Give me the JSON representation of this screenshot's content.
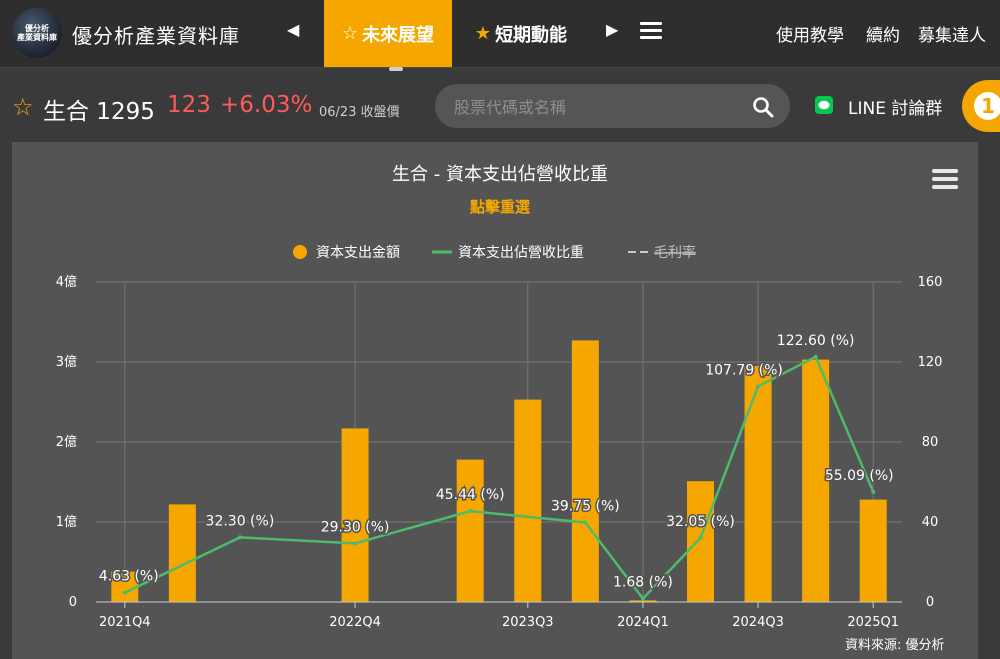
{
  "nav": {
    "logo_line1": "優分析",
    "logo_line2": "產業資料庫",
    "site_title": "優分析產業資料庫",
    "tabs": [
      {
        "label": "未來展望",
        "active": true
      },
      {
        "label": "短期動能",
        "active": false
      }
    ],
    "right_links": [
      "使用教學",
      "續約",
      "募集達人"
    ]
  },
  "stock": {
    "name_code": "生合 1295",
    "price": "123",
    "change": "+6.03%",
    "date_note": "06/23 收盤價"
  },
  "search": {
    "placeholder": "股票代碼或名稱"
  },
  "line_group": "LINE 討論群",
  "badge_number": "1",
  "colors": {
    "accent": "#f5a700",
    "up": "#ff5a5a",
    "line": "#4cbb6c"
  },
  "chart_data": {
    "type": "bar+line",
    "title": "生合 - 資本支出佔營收比重",
    "subtitle": "點擊重選",
    "legend": [
      {
        "name": "資本支出金額",
        "marker": "circle",
        "color": "#f5a700"
      },
      {
        "name": "資本支出佔營收比重",
        "marker": "line",
        "color": "#4cbb6c"
      },
      {
        "name": "毛利率",
        "marker": "dash",
        "color": "#cccccc",
        "disabled": true
      }
    ],
    "categories": [
      "2021Q4",
      "2022Q1",
      "2022Q2",
      "2022Q3",
      "2022Q4",
      "2023Q1",
      "2023Q2",
      "2023Q3",
      "2023Q4",
      "2024Q1",
      "2024Q2",
      "2024Q3",
      "2024Q4",
      "2025Q1"
    ],
    "x_tick_labels": {
      "0": "2021Q4",
      "4": "2022Q4",
      "7": "2023Q3",
      "9": "2024Q1",
      "11": "2024Q3",
      "13": "2025Q1"
    },
    "series": [
      {
        "name": "資本支出金額",
        "axis": "left",
        "unit": "億",
        "values": [
          0.38,
          1.22,
          null,
          null,
          2.17,
          null,
          1.78,
          2.53,
          3.27,
          0.02,
          1.51,
          2.95,
          3.03,
          1.28
        ]
      },
      {
        "name": "資本支出佔營收比重",
        "axis": "right",
        "values": [
          4.63,
          null,
          32.3,
          null,
          29.3,
          null,
          45.44,
          null,
          39.75,
          1.68,
          32.05,
          107.79,
          122.6,
          55.09
        ],
        "labels": [
          "4.63 (%)",
          null,
          "32.30 (%)",
          null,
          "29.30 (%)",
          null,
          "45.44 (%)",
          null,
          "39.75 (%)",
          "1.68 (%)",
          "32.05 (%)",
          "107.79 (%)",
          "122.60 (%)",
          "55.09 (%)"
        ]
      }
    ],
    "y_left": {
      "ticks": [
        0,
        1,
        2,
        3,
        4
      ],
      "tick_labels": [
        "0",
        "1億",
        "2億",
        "3億",
        "4億"
      ],
      "ylim": [
        0,
        4
      ]
    },
    "y_right": {
      "ticks": [
        0,
        40,
        80,
        120,
        160
      ],
      "tick_labels": [
        "0",
        "40",
        "80",
        "120",
        "160"
      ],
      "ylim": [
        0,
        160
      ]
    },
    "grid": true
  },
  "source_note": "資料來源: 優分析"
}
